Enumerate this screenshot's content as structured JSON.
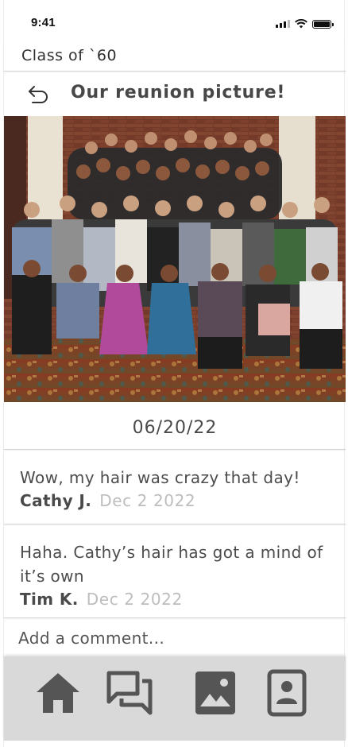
{
  "status_bar": {
    "time": "9:41"
  },
  "header": {
    "group_title": "Class of `60"
  },
  "post": {
    "title": "Our reunion picture!",
    "date": "06/20/22"
  },
  "comments": [
    {
      "text": "Wow, my hair was crazy that day!",
      "author": "Cathy J.",
      "date": "Dec 2 2022"
    },
    {
      "text": "Haha. Cathy’s hair has got a mind of it’s own",
      "author": "Tim K.",
      "date": "Dec 2 2022"
    }
  ],
  "add_comment": {
    "placeholder": "Add a comment..."
  },
  "nav": {
    "items": [
      {
        "icon": "home-icon"
      },
      {
        "icon": "chat-icon"
      },
      {
        "icon": "photos-icon"
      },
      {
        "icon": "contacts-icon"
      }
    ]
  },
  "colors": {
    "nav_background": "#d9d9d9",
    "icon": "#555555",
    "muted_text": "#bdbdbd"
  }
}
